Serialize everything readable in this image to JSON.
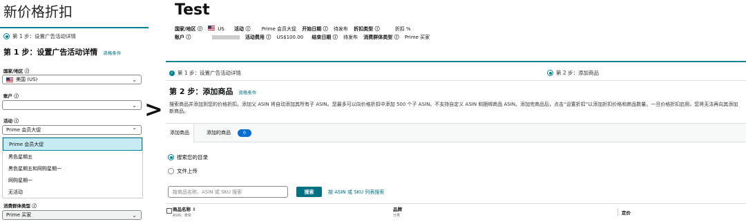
{
  "left": {
    "title": "新价格折扣",
    "step1_label": "第 1 步：设置广告活动详情",
    "heading": "第 1 步：设置广告活动详情",
    "eligibility_link": "资格条件",
    "country_label": "国家/地区 ⓘ",
    "country_value": "美国 (US)",
    "account_label": "账户 ⓘ",
    "account_value": "",
    "event_label": "活动 ⓘ",
    "event_value": "Prime 会员大促",
    "event_options": [
      "Prime 会员大促",
      "黑色星期五",
      "黑色星期五和网购星期一",
      "网购星期一",
      "无活动"
    ],
    "audience_label": "消费群体类型 ⓘ",
    "audience_value": "Prime 买家"
  },
  "arrow": ">",
  "right": {
    "title": "Test",
    "meta": {
      "country_k": "国家/地区 ⓘ",
      "country_v": "US",
      "account_k": "账户 ⓘ",
      "event_k": "活动 ⓘ",
      "event_v": "Prime 会员大促",
      "fee_k": "活动费用 ⓘ",
      "fee_v": "US$100.00",
      "start_k": "开始日期 ⓘ",
      "start_v": "待发布",
      "end_k": "结束日期 ⓘ",
      "end_v": "待发布",
      "disc_k": "折扣类型 ⓘ",
      "disc_v": "折扣 %",
      "aud_k": "消费群体类型 ⓘ",
      "aud_v": "Prime 买家"
    },
    "step1_done": "第 1 步：设置广告活动详情",
    "step2": "第 2 步：添加商品",
    "heading": "第 2 步：添加商品",
    "eligibility_link": "资格条件",
    "description": "搜索商品并添加到您的价格折扣。添加父 ASIN 将自动添加其所有子 ASIN。您最多可以向价格折扣中添加 500 个子 ASIN。不支持自定义 ASIN 和捆绑商品 ASIN。添加完商品后，点击“设置折扣”以添加折扣价格和商品数量。一旦价格折扣启用，您将无法再向其添加新商品。",
    "tab_add": "添加商品",
    "tab_added": "添加的商品",
    "added_count": "0",
    "opt_catalog": "搜索您的目录",
    "opt_upload": "文件上传",
    "search_placeholder": "按商品名称、ASIN 或 SKU 搜索",
    "search_btn": "搜索",
    "asin_link": "按 ASIN 或 SKU 列表搜索",
    "col_name": "商品名称",
    "col_name_sub": "ASIN，表体",
    "col_brand": "品牌",
    "col_brand_sub": "分类",
    "col_price": "定价"
  }
}
